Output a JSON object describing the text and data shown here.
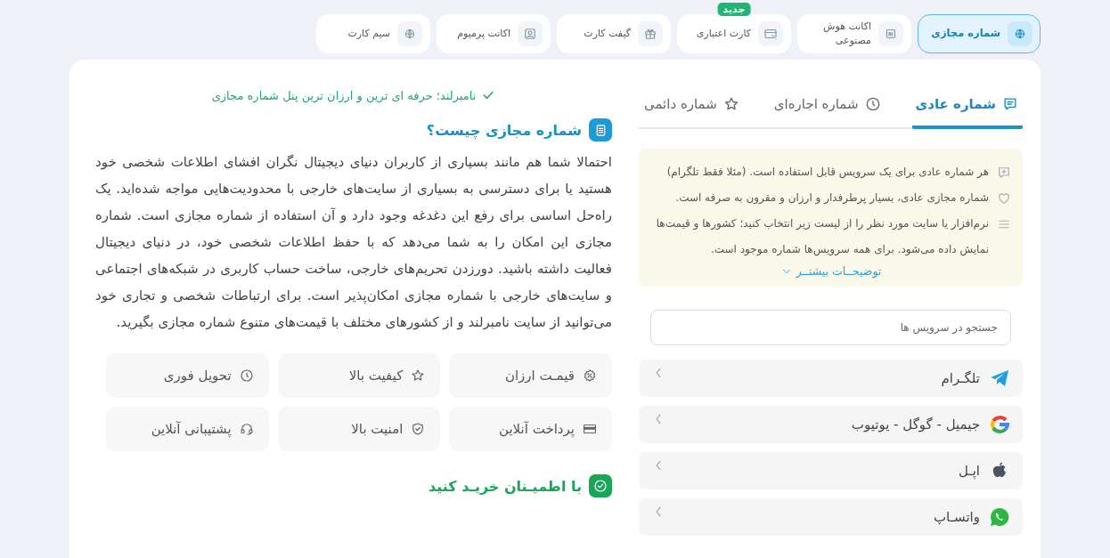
{
  "nav": [
    {
      "label": "شماره مجازی",
      "selected": true
    },
    {
      "label": "اکانت هوش مصنوعی",
      "selected": false
    },
    {
      "label": "کارت اعتباری",
      "selected": false,
      "badge": "جدید"
    },
    {
      "label": "گیفت کارت",
      "selected": false
    },
    {
      "label": "اکانت پرمیوم",
      "selected": false
    },
    {
      "label": "سیم کارت",
      "selected": false
    }
  ],
  "tabs": [
    {
      "label": "شماره عادی",
      "selected": true
    },
    {
      "label": "شماره اجاره‌ای",
      "selected": false
    },
    {
      "label": "شماره دائمی",
      "selected": false
    }
  ],
  "info": {
    "items": [
      "هر شماره عادی برای یک سرویس قابل استفاده است. (مثلا فقط تلگرام)",
      "شماره مجازی عادی، بسیار پرطرفدار و ارزان و مقرون به صرفه است.",
      "نرم‌افزار یا سایت مورد نظر را از لیست زیر انتخاب کنید؛ کشورها و قیمت‌ها نمایش داده می‌شود. برای همه سرویس‌ها شماره موجود است."
    ],
    "more_link": "توضیحــات بیشتــر"
  },
  "search": {
    "placeholder": "جستجو در سرویس ها"
  },
  "services": [
    "تلگـرام",
    "جیمیل - گوگل - یوتیوب",
    "اپـل",
    "واتسـاپ"
  ],
  "tagline": "نامبرلند؛ حرفه ای ترین و ارزان ترین پنل شماره مجازی",
  "heading": "شماره مجازی چیست؟",
  "paragraph": "احتمالا شما هم مانند بسیاری از کاربران دنیای دیجیتال نگران افشای اطلاعات شخصی خود هستید یا برای دسترسی به بسیاری از سایت‌های خارجی با محدودیت‌هایی مواجه شده‌اید. یک راه‌حل اساسی برای رفع این دغدغه وجود دارد و آن استفاده از شماره مجازی است. شماره مجازی این امکان را به شما می‌دهد که با حفظ اطلاعات شخصی خود، در دنیای دیجیتال فعالیت داشته باشید. دورزدن تحریم‌های خارجی، ساخت حساب کاربری در شبکه‌های اجتماعی و سایت‌های خارجی با شماره مجازی امکان‌پذیر است. برای ارتباطات شخصی و تجاری خود می‌توانید از سایت نامبرلند و از کشورهای مختلف با قیمت‌های متنوع شماره مجازی بگیرید.",
  "features": [
    "قیمـت ارزان",
    "کیفیت بالا",
    "تحویل فوری",
    "پرداخت آنلاین",
    "امنیت بالا",
    "پشتیبانی آنلاین"
  ],
  "heading2": "با اطمیـنان خریـد کنید"
}
